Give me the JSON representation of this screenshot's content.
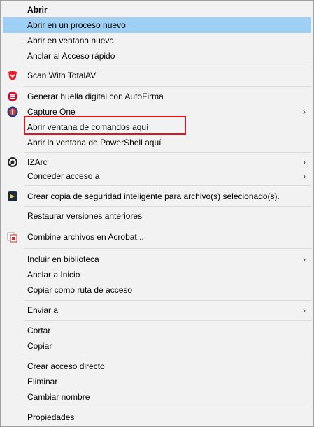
{
  "menu": {
    "items": [
      {
        "label": "Abrir",
        "bold": true
      },
      {
        "label": "Abrir en un proceso nuevo",
        "highlighted": true
      },
      {
        "label": "Abrir en ventana nueva"
      },
      {
        "label": "Anclar al Acceso rápido"
      },
      {
        "label": "Scan With TotalAV",
        "icon": "totalav-shield-icon"
      },
      {
        "label": "Generar huella digital con AutoFirma",
        "icon": "autofirma-icon"
      },
      {
        "label": "Capture One",
        "icon": "capture-one-icon",
        "submenu": true
      },
      {
        "label": "Abrir ventana de comandos aquí",
        "outlined": true
      },
      {
        "label": "Abrir la ventana de PowerShell aquí"
      },
      {
        "label": "IZArc",
        "icon": "izarc-icon",
        "submenu": true
      },
      {
        "label": "Conceder acceso a",
        "submenu": true
      },
      {
        "label": "Crear copia de seguridad inteligente para archivo(s) selecionado(s).",
        "icon": "backup-icon"
      },
      {
        "label": "Restaurar versiones anteriores"
      },
      {
        "label": "Combine archivos en Acrobat...",
        "icon": "acrobat-icon"
      },
      {
        "label": "Incluir en biblioteca",
        "submenu": true
      },
      {
        "label": "Anclar a Inicio"
      },
      {
        "label": "Copiar como ruta de acceso"
      },
      {
        "label": "Enviar a",
        "submenu": true
      },
      {
        "label": "Cortar"
      },
      {
        "label": "Copiar"
      },
      {
        "label": "Crear acceso directo"
      },
      {
        "label": "Eliminar"
      },
      {
        "label": "Cambiar nombre"
      },
      {
        "label": "Propiedades"
      }
    ],
    "submenu_arrow": "›",
    "colors": {
      "highlight": "#9ed0f5",
      "outline": "#e0161c",
      "background": "#f2f2f2"
    }
  }
}
